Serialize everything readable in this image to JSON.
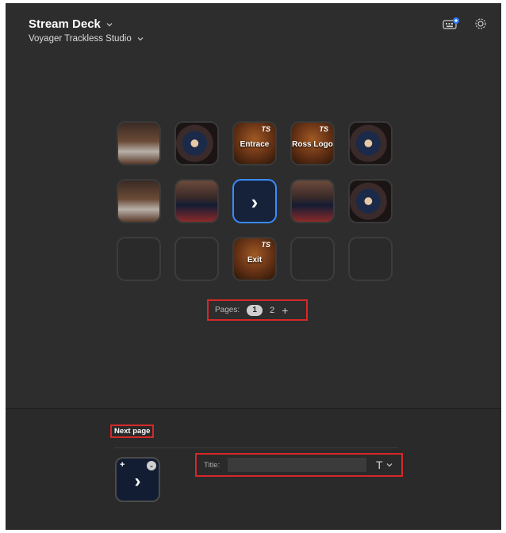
{
  "header": {
    "device": "Stream Deck",
    "profile": "Voyager Trackless Studio"
  },
  "grid": {
    "rows": [
      [
        {
          "type": "image",
          "image": "studio-set-voyager-logo"
        },
        {
          "type": "image",
          "image": "presenter-woman-voyager"
        },
        {
          "type": "ts",
          "label": "Entrace",
          "badge": "TS"
        },
        {
          "type": "ts",
          "label": "Ross Logo",
          "badge": "TS"
        },
        {
          "type": "image",
          "image": "presenter-woman-red"
        }
      ],
      [
        {
          "type": "image",
          "image": "studio-set-voyager-logo"
        },
        {
          "type": "image",
          "image": "studio-voyager-desk"
        },
        {
          "type": "selected",
          "icon": "chevron-right-icon"
        },
        {
          "type": "image",
          "image": "studio-voyager-desk"
        },
        {
          "type": "image",
          "image": "presenter-woman-standing"
        }
      ],
      [
        {
          "type": "empty"
        },
        {
          "type": "empty"
        },
        {
          "type": "ts",
          "label": "Exit",
          "badge": "TS"
        },
        {
          "type": "empty"
        },
        {
          "type": "empty"
        }
      ]
    ]
  },
  "pages": {
    "label": "Pages:",
    "items": [
      "1",
      "2"
    ],
    "current": "1",
    "add_symbol": "+"
  },
  "inspector": {
    "action_name": "Next page",
    "title_label": "Title:",
    "title_value": "",
    "title_placeholder": "",
    "text_button_symbol": "T",
    "preview_plus": "+",
    "preview_arrow": "›"
  },
  "colors": {
    "accent": "#3a8bff",
    "highlight": "#d62828",
    "app_bg": "#2d2d2d"
  }
}
